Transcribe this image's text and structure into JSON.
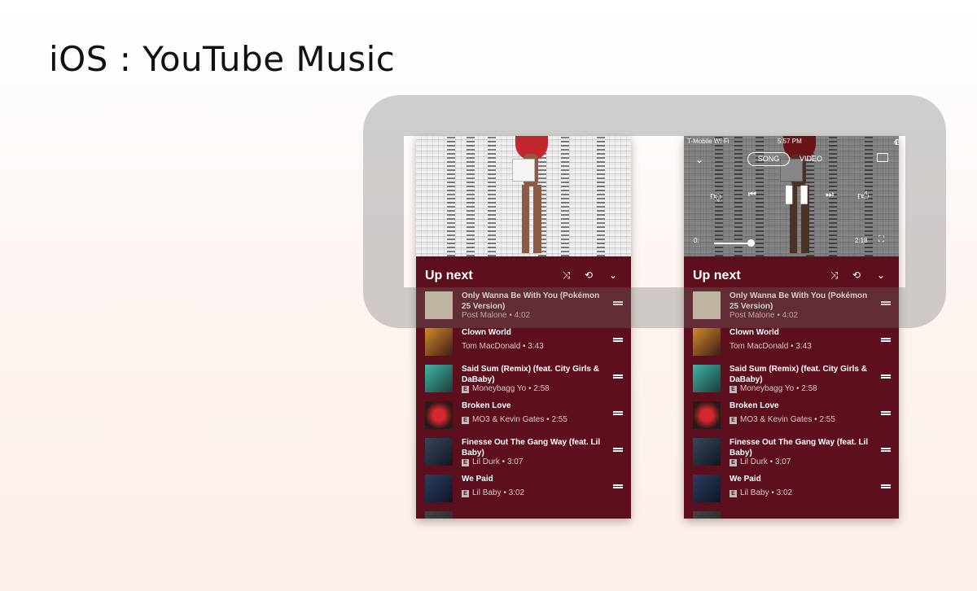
{
  "page": {
    "title": "iOS : YouTube Music"
  },
  "status_bar": {
    "carrier": "T-Mobile Wi-Fi",
    "time": "5:57 PM",
    "battery": "6%"
  },
  "player": {
    "tabs": [
      "SONG",
      "VIDEO"
    ],
    "elapsed": "0:",
    "duration": "2:18",
    "progress_fraction": 0.35
  },
  "up_next": {
    "title": "Up next",
    "items": [
      {
        "title": "Only Wanna Be With You (Pokémon 25 Version)",
        "artist": "Post Malone",
        "duration": "4:02",
        "explicit": false
      },
      {
        "title": "Clown World",
        "artist": "Tom MacDonald",
        "duration": "3:43",
        "explicit": false
      },
      {
        "title": "Said Sum (Remix) (feat. City Girls & DaBaby)",
        "artist": "Moneybagg Yo",
        "duration": "2:58",
        "explicit": true
      },
      {
        "title": "Broken Love",
        "artist": "MO3 & Kevin Gates",
        "duration": "2:55",
        "explicit": true
      },
      {
        "title": "Finesse Out The Gang Way (feat. Lil Baby)",
        "artist": "Lil Durk",
        "duration": "3:07",
        "explicit": true
      },
      {
        "title": "We Paid",
        "artist": "Lil Baby",
        "duration": "3:02",
        "explicit": true
      }
    ]
  },
  "colors": {
    "queue_background": "#5e0f1d",
    "highlight_ring": "#6e6e6e"
  },
  "icons": [
    "chevron-down-icon",
    "cast-icon",
    "thumbs-down-icon",
    "previous-icon",
    "pause-icon",
    "next-icon",
    "thumbs-up-icon",
    "fullscreen-icon",
    "shuffle-icon",
    "repeat-icon",
    "drag-handle-icon"
  ]
}
